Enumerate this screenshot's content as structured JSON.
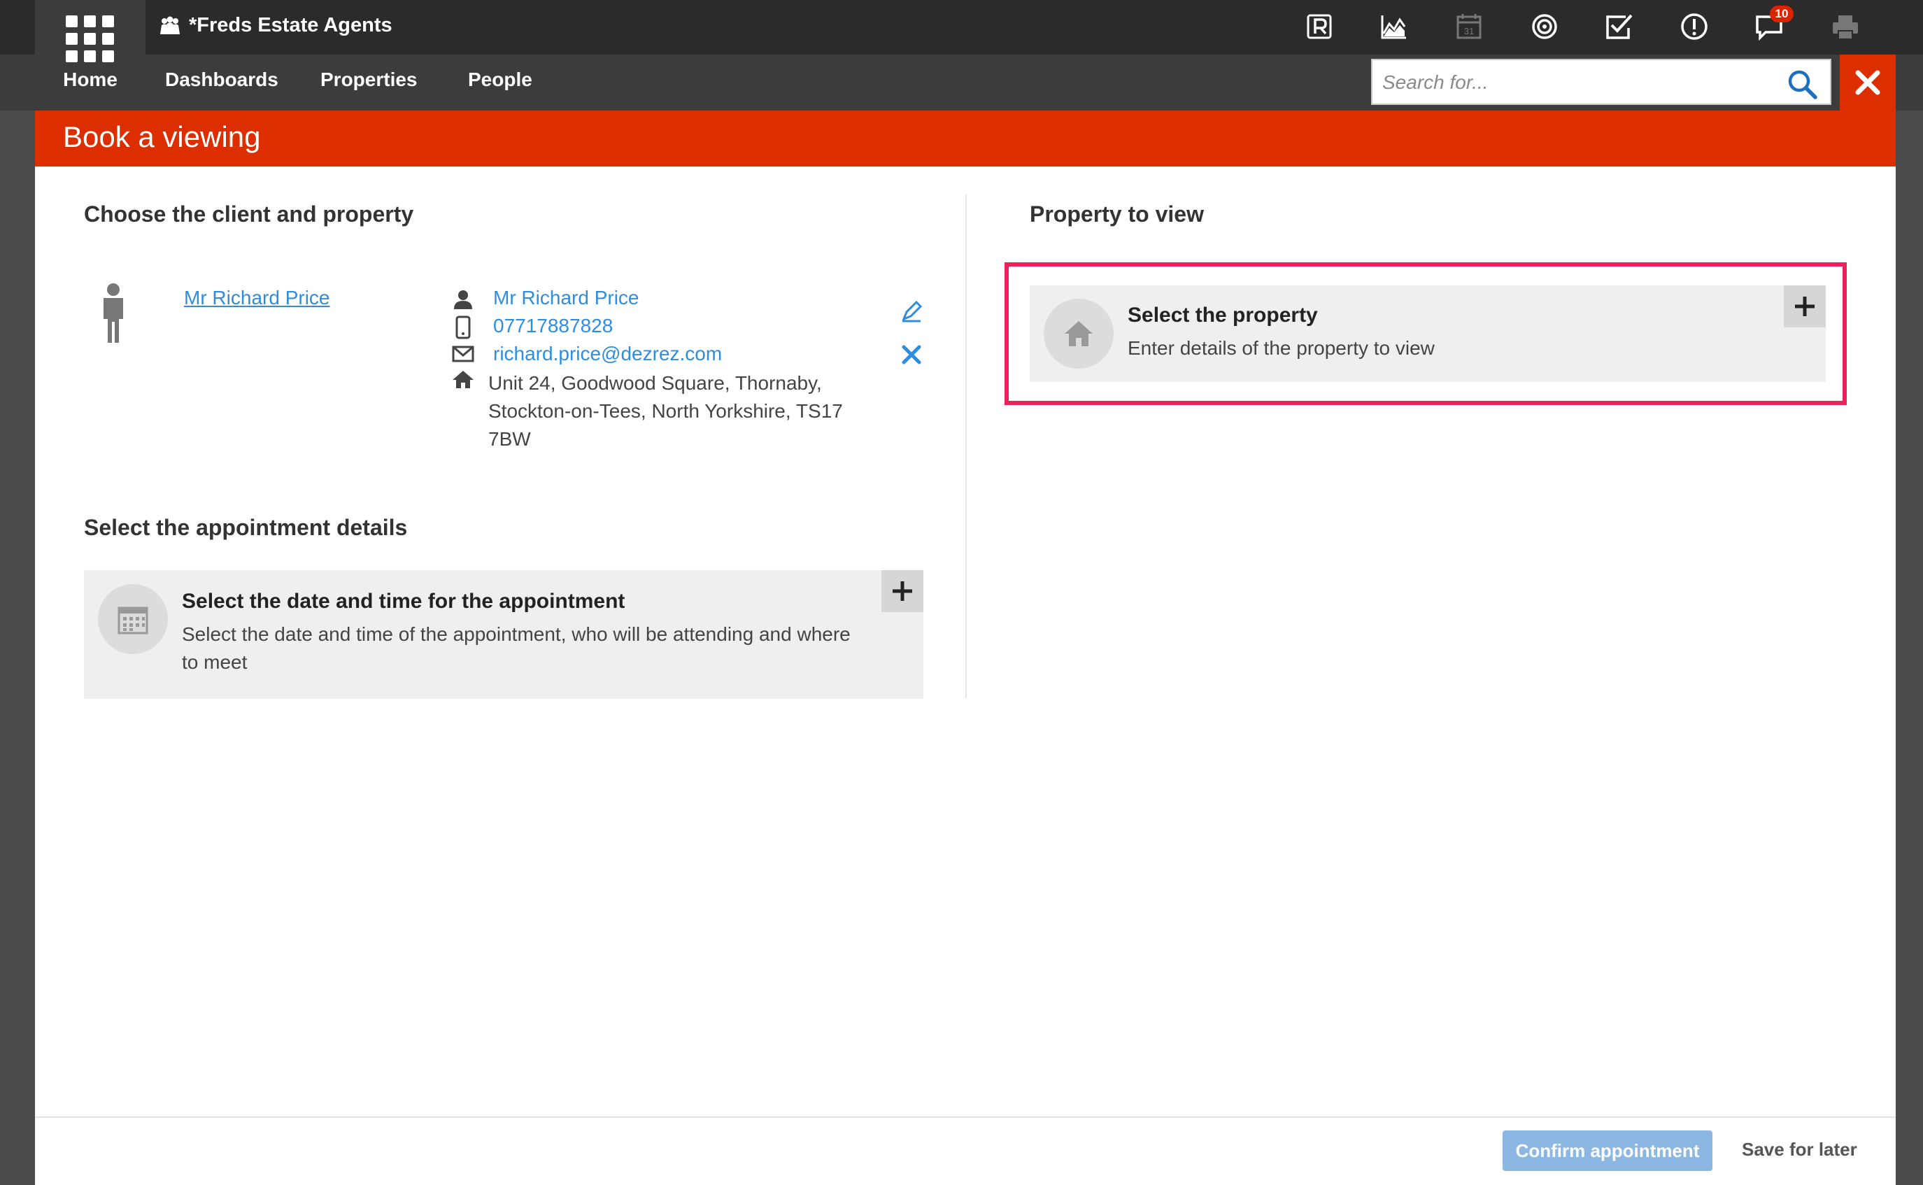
{
  "app": {
    "title": "*Freds Estate Agents",
    "notification_count": "10"
  },
  "nav": {
    "home": "Home",
    "dashboards": "Dashboards",
    "properties": "Properties",
    "people": "People"
  },
  "search": {
    "placeholder": "Search for..."
  },
  "modal": {
    "title": "Book a viewing",
    "client_section": {
      "heading": "Choose the client and property",
      "client_link": "Mr Richard Price",
      "contact_name": "Mr Richard Price",
      "phone": "07717887828",
      "email": "richard.price@dezrez.com",
      "address_line1": "Unit 24, Goodwood Square, Thornaby,",
      "address_line2": "Stockton-on-Tees, North Yorkshire, TS17",
      "address_line3": "7BW"
    },
    "appointment_section": {
      "heading": "Select the appointment details",
      "card_title": "Select the date and time for the appointment",
      "card_desc_line1": "Select the date and time of the appointment, who will be attending and where",
      "card_desc_line2": "to meet"
    },
    "property_section": {
      "heading": "Property to view",
      "card_title": "Select the property",
      "card_desc": "Enter details of the property to view"
    },
    "footer": {
      "confirm": "Confirm appointment",
      "save_later": "Save for later"
    }
  },
  "colors": {
    "accent": "#dd2e00",
    "link": "#2e8de0",
    "highlight": "#ee1f5a",
    "confirm_button": "#8cb7e2"
  },
  "icons": [
    "apps-grid-icon",
    "people-icon",
    "r-logo-icon",
    "chart-icon",
    "calendar-icon",
    "target-icon",
    "checkbox-icon",
    "alert-icon",
    "chat-icon",
    "printer-icon",
    "search-icon",
    "close-icon",
    "person-icon",
    "user-icon",
    "phone-icon",
    "envelope-icon",
    "home-icon",
    "edit-icon",
    "remove-icon",
    "plus-icon"
  ]
}
